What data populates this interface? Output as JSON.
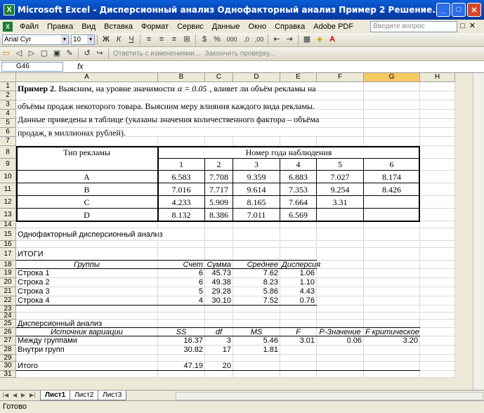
{
  "window": {
    "title": "Microsoft Excel - Дисперсионный анализ Однофакторный анализ Пример 2 Решение.xls",
    "icon": "excel-icon",
    "min": "_",
    "max": "□",
    "close": "✕"
  },
  "menu": [
    "Файл",
    "Правка",
    "Вид",
    "Вставка",
    "Формат",
    "Сервис",
    "Данные",
    "Окно",
    "Справка",
    "Adobe PDF"
  ],
  "question_box": {
    "placeholder": "Введите вопрос"
  },
  "toolbar": {
    "font": "Arial Cyr",
    "size": "10",
    "review_text": "Ответить с изменениями...",
    "end_review": "Закончить проверку..."
  },
  "formula_bar": {
    "cell": "G46",
    "fx": "fx",
    "value": ""
  },
  "columns": [
    "A",
    "B",
    "C",
    "D",
    "E",
    "F",
    "G",
    "H"
  ],
  "rows": [
    "1",
    "2",
    "3",
    "4",
    "5",
    "6",
    "7",
    "8",
    "9",
    "10",
    "11",
    "12",
    "13",
    "14",
    "15",
    "16",
    "17",
    "18",
    "19",
    "20",
    "21",
    "22",
    "23",
    "24",
    "25",
    "26",
    "27",
    "28",
    "29",
    "30",
    "31"
  ],
  "text": {
    "l1a": "Пример 2",
    "l1b": ". Выясним, на уровне значимости",
    "l1c": "α = 0.05",
    "l1d": ", влияет ли объём рекламы на",
    "l2": "объёмы продаж некоторого товара. Выясним меру влияния каждого вида рекламы.",
    "l3": "Данные приведены в таблице (указаны значения количественного фактора – объёма",
    "l4": "продаж, в миллионах рублей)."
  },
  "table1": {
    "type_header": "Тип рекламы",
    "year_header": "Номер года наблюдения",
    "years": [
      "1",
      "2",
      "3",
      "4",
      "5",
      "6"
    ],
    "rows": [
      {
        "label": "A",
        "values": [
          "6.583",
          "7.708",
          "9.359",
          "6.883",
          "7.027",
          "8.174"
        ]
      },
      {
        "label": "B",
        "values": [
          "7.016",
          "7.717",
          "9.614",
          "7.353",
          "9.254",
          "8.426"
        ]
      },
      {
        "label": "C",
        "values": [
          "4.233",
          "5.909",
          "8.165",
          "7.664",
          "3.31",
          ""
        ]
      },
      {
        "label": "D",
        "values": [
          "8.132",
          "8.386",
          "7.011",
          "6.569",
          "",
          ""
        ]
      }
    ]
  },
  "anova_title": "Однофакторный дисперсионный анализ",
  "itogi": "ИТОГИ",
  "summary": {
    "headers": [
      "Группы",
      "Счет",
      "Сумма",
      "Среднее",
      "Дисперсия"
    ],
    "rows": [
      [
        "Строка 1",
        "6",
        "45.73",
        "7.62",
        "1.06"
      ],
      [
        "Строка 2",
        "6",
        "49.38",
        "8.23",
        "1.10"
      ],
      [
        "Строка 3",
        "5",
        "29.28",
        "5.86",
        "4.43"
      ],
      [
        "Строка 4",
        "4",
        "30.10",
        "7.52",
        "0.76"
      ]
    ]
  },
  "anova_label": "Дисперсионный анализ",
  "anova": {
    "headers": [
      "Источник вариации",
      "SS",
      "df",
      "MS",
      "F",
      "P-Значение",
      "F критическое"
    ],
    "rows": [
      [
        "Между группами",
        "16.37",
        "3",
        "5.46",
        "3.01",
        "0.06",
        "3.20"
      ],
      [
        "Внутри групп",
        "30.82",
        "17",
        "1.81",
        "",
        "",
        ""
      ],
      [
        "",
        "",
        "",
        "",
        "",
        "",
        ""
      ],
      [
        "Итого",
        "47.19",
        "20",
        "",
        "",
        "",
        ""
      ]
    ]
  },
  "sheets": [
    "Лист1",
    "Лист2",
    "Лист3"
  ],
  "status": "Готово"
}
